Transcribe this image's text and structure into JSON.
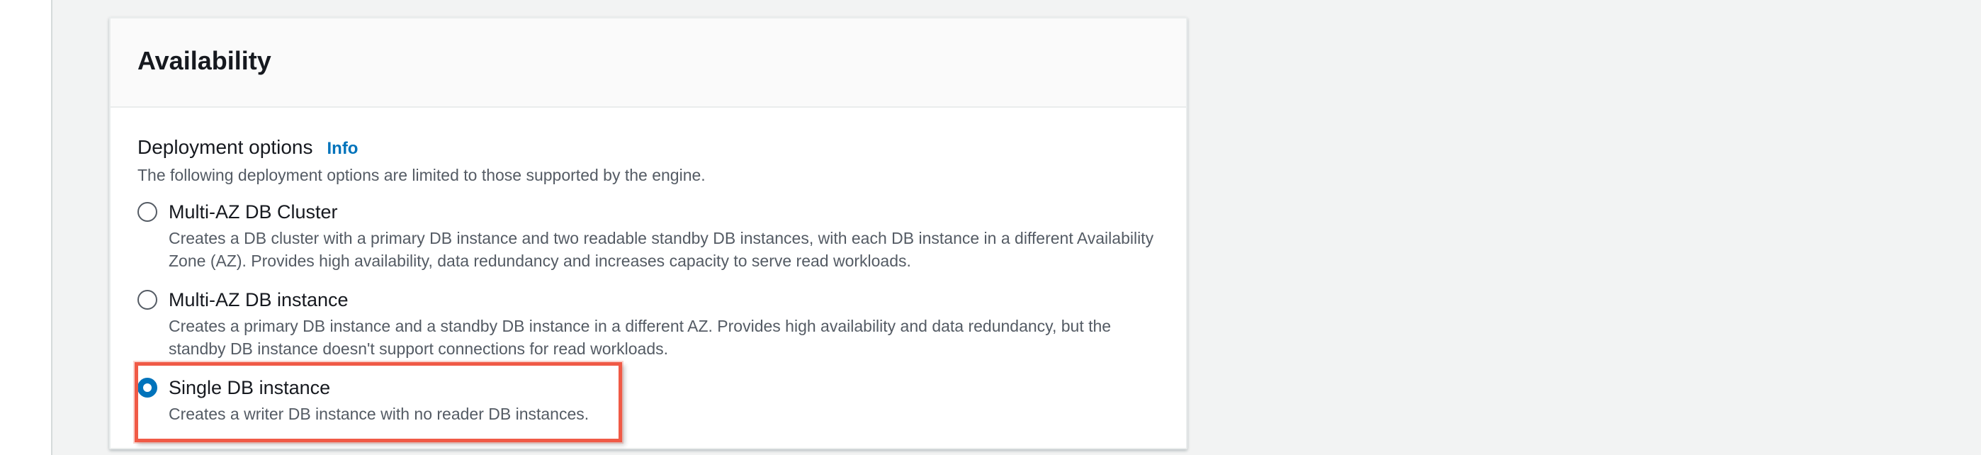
{
  "panel": {
    "title": "Availability"
  },
  "deployment": {
    "label": "Deployment options",
    "info_link": "Info",
    "description": "The following deployment options are limited to those supported by the engine.",
    "options": [
      {
        "label": "Multi-AZ DB Cluster",
        "description": "Creates a DB cluster with a primary DB instance and two readable standby DB instances, with each DB instance in a different Availability Zone (AZ). Provides high availability, data redundancy and increases capacity to serve read workloads.",
        "selected": false
      },
      {
        "label": "Multi-AZ DB instance",
        "description": "Creates a primary DB instance and a standby DB instance in a different AZ. Provides high availability and data redundancy, but the standby DB instance doesn't support connections for read workloads.",
        "selected": false
      },
      {
        "label": "Single DB instance",
        "description": "Creates a writer DB instance with no reader DB instances.",
        "selected": true
      }
    ]
  },
  "colors": {
    "accent": "#0073bb",
    "highlight": "#f05a46"
  }
}
